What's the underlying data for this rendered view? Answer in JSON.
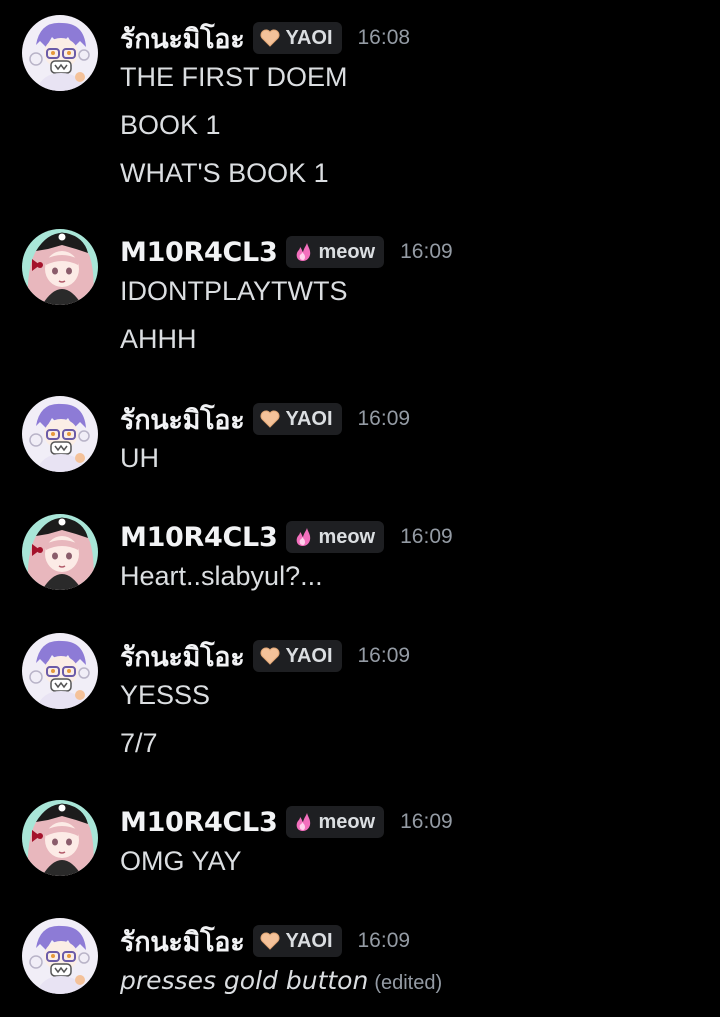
{
  "users": {
    "rak": {
      "name": "รักนะมิโอะ",
      "tag": "YAOI",
      "tag_icon": "peach-heart-icon",
      "tag_color": "#f4c29a",
      "avatar": "purple-hair-character-avatar"
    },
    "miracle": {
      "name": "M10R4CL3",
      "tag": "meow",
      "tag_icon": "pink-flame-icon",
      "tag_color": "#f36fbd",
      "avatar": "pink-hair-gothic-character-avatar"
    }
  },
  "messages": [
    {
      "user": "rak",
      "name": "รักนะมิโอะ",
      "tag": "YAOI",
      "time": "16:08",
      "lines": [
        "THE FIRST DOEM",
        "BOOK 1",
        "WHAT'S BOOK 1"
      ]
    },
    {
      "user": "miracle",
      "name": "M10R4CL3",
      "tag": "meow",
      "time": "16:09",
      "lines": [
        "IDONTPLAYTWTS",
        "AHHH"
      ]
    },
    {
      "user": "rak",
      "name": "รักนะมิโอะ",
      "tag": "YAOI",
      "time": "16:09",
      "lines": [
        "UH"
      ]
    },
    {
      "user": "miracle",
      "name": "M10R4CL3",
      "tag": "meow",
      "time": "16:09",
      "lines": [
        "Heart..slabyul?..."
      ]
    },
    {
      "user": "rak",
      "name": "รักนะมิโอะ",
      "tag": "YAOI",
      "time": "16:09",
      "lines": [
        "YESSS",
        "7/7"
      ]
    },
    {
      "user": "miracle",
      "name": "M10R4CL3",
      "tag": "meow",
      "time": "16:09",
      "lines": [
        "OMG YAY"
      ]
    },
    {
      "user": "rak",
      "name": "รักนะมิโอะ",
      "tag": "YAOI",
      "time": "16:09",
      "lines": [
        "presses gold button"
      ],
      "edited": "(edited)"
    }
  ],
  "colors": {
    "background": "#000000",
    "username": "#f2f3f5",
    "text": "#dbdee1",
    "muted": "#949ba4",
    "tag_bg": "#1e1f22"
  }
}
